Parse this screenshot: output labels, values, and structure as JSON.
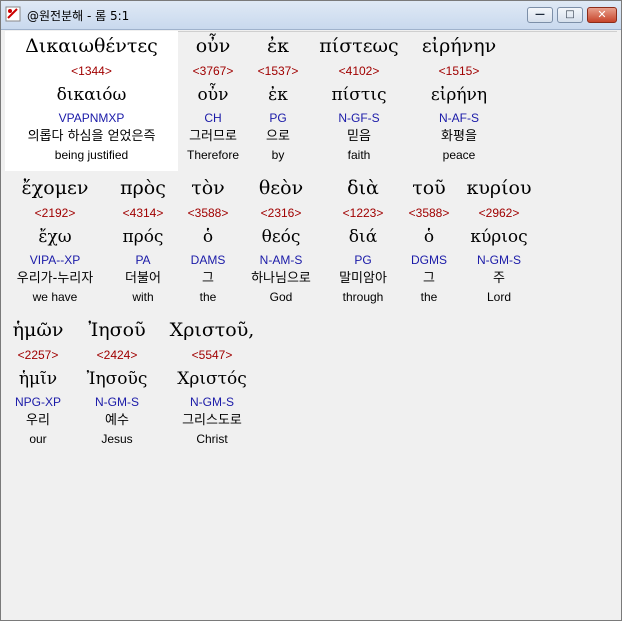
{
  "window": {
    "title": "@원전분해 - 롬 5:1",
    "controls": {
      "minimize": "—",
      "maximize": "□",
      "close": "✕"
    },
    "icon": "app-logo-icon"
  },
  "rows": [
    [
      {
        "greek": "Δικαιωθέντες",
        "strong": "<1344>",
        "lemma": "δικαιόω",
        "morph": "VPAPNMXP",
        "korean": "의롭다 하심을 얻었은즉",
        "english": "being justified"
      },
      {
        "greek": "οὖν",
        "strong": "<3767>",
        "lemma": "οὖν",
        "morph": "CH",
        "korean": "그러므로",
        "english": "Therefore"
      },
      {
        "greek": "ἐκ",
        "strong": "<1537>",
        "lemma": "ἐκ",
        "morph": "PG",
        "korean": "으로",
        "english": "by"
      },
      {
        "greek": "πίστεως",
        "strong": "<4102>",
        "lemma": "πίστις",
        "morph": "N-GF-S",
        "korean": "믿음",
        "english": "faith"
      },
      {
        "greek": "εἰρήνην",
        "strong": "<1515>",
        "lemma": "εἰρήνη",
        "morph": "N-AF-S",
        "korean": "화평을",
        "english": "peace"
      }
    ],
    [
      {
        "greek": "ἔχομεν",
        "strong": "<2192>",
        "lemma": "ἔχω",
        "morph": "VIPA--XP",
        "korean": "우리가-누리자",
        "english": "we have"
      },
      {
        "greek": "πρὸς",
        "strong": "<4314>",
        "lemma": "πρός",
        "morph": "PA",
        "korean": "더불어",
        "english": "with"
      },
      {
        "greek": "τὸν",
        "strong": "<3588>",
        "lemma": "ὁ",
        "morph": "DAMS",
        "korean": "그",
        "english": "the"
      },
      {
        "greek": "θεὸν",
        "strong": "<2316>",
        "lemma": "θεός",
        "morph": "N-AM-S",
        "korean": "하나님으로",
        "english": "God"
      },
      {
        "greek": "διὰ",
        "strong": "<1223>",
        "lemma": "διά",
        "morph": "PG",
        "korean": "말미암아",
        "english": "through"
      },
      {
        "greek": "τοῦ",
        "strong": "<3588>",
        "lemma": "ὁ",
        "morph": "DGMS",
        "korean": "그",
        "english": "the"
      },
      {
        "greek": "κυρίου",
        "strong": "<2962>",
        "lemma": "κύριος",
        "morph": "N-GM-S",
        "korean": "주",
        "english": "Lord"
      }
    ],
    [
      {
        "greek": "ἡμῶν",
        "strong": "<2257>",
        "lemma": "ἡμῖν",
        "morph": "NPG-XP",
        "korean": "우리",
        "english": "our"
      },
      {
        "greek": "Ἰησοῦ",
        "strong": "<2424>",
        "lemma": "Ἰησοῦς",
        "morph": "N-GM-S",
        "korean": "예수",
        "english": "Jesus"
      },
      {
        "greek": "Χριστοῦ,",
        "strong": "<5547>",
        "lemma": "Χριστός",
        "morph": "N-GM-S",
        "korean": "그리스도로",
        "english": "Christ"
      }
    ]
  ]
}
